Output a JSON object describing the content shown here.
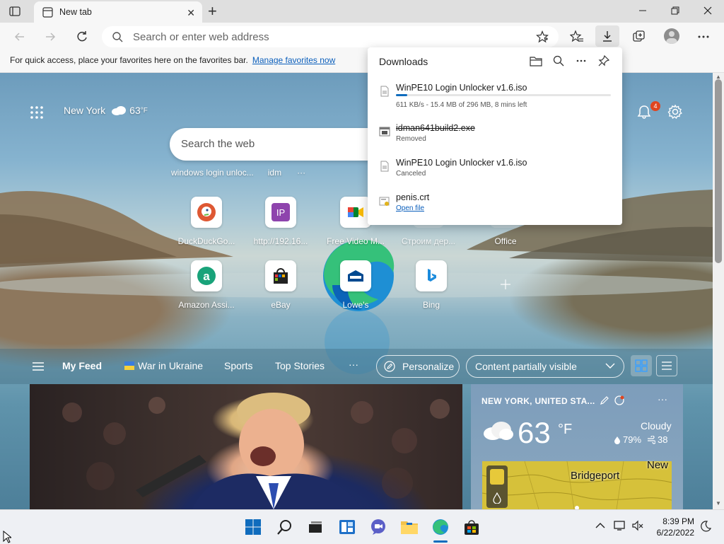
{
  "browser": {
    "tab_title": "New tab",
    "tab_close": "✕",
    "new_tab": "+",
    "omnibox_placeholder": "Search or enter web address",
    "favbar_message": "For quick access, place your favorites here on the favorites bar.",
    "favbar_link": "Manage favorites now"
  },
  "newtab": {
    "location": "New York",
    "temp": "63",
    "temp_unit": "°F",
    "search_placeholder": "Search the web",
    "recent_searches": [
      "windows login unloc...",
      "idm"
    ],
    "notifications_count": "4",
    "quick_links_row1": [
      {
        "label": "DuckDuckGo...",
        "icon": "duckduckgo-icon"
      },
      {
        "label": "http://192.16...",
        "icon": "ip-icon"
      },
      {
        "label": "Free Video M...",
        "icon": "meet-icon"
      },
      {
        "label": "Строим дер...",
        "icon": "generic-icon"
      },
      {
        "label": "Office",
        "icon": "office-icon"
      }
    ],
    "quick_links_row2": [
      {
        "label": "Amazon Assi...",
        "icon": "amazon-icon"
      },
      {
        "label": "eBay",
        "icon": "ebay-icon"
      },
      {
        "label": "Lowe's",
        "icon": "lowes-icon"
      },
      {
        "label": "Bing",
        "icon": "bing-icon"
      }
    ],
    "feed": {
      "my_feed": "My Feed",
      "tabs": [
        "War in Ukraine",
        "Sports",
        "Top Stories"
      ],
      "more": "···",
      "personalize": "Personalize",
      "content_visibility": "Content partially visible"
    },
    "weather_card": {
      "location": "NEW YORK, UNITED STA...",
      "temp": "63",
      "unit": "°F",
      "condition": "Cloudy",
      "humidity": "79%",
      "aqi": "38",
      "map_city": "Bridgeport",
      "map_state": "New"
    }
  },
  "downloads": {
    "title": "Downloads",
    "items": [
      {
        "name": "WinPE10 Login Unlocker v1.6.iso",
        "status": "611 KB/s - 15.4 MB of 296 MB, 8 mins left",
        "progress": 0.052,
        "icon": "file-icon"
      },
      {
        "name": "idman641build2.exe",
        "status": "Removed",
        "icon": "exe-icon"
      },
      {
        "name": "WinPE10 Login Unlocker v1.6.iso",
        "status": "Canceled",
        "icon": "file-icon"
      },
      {
        "name": "penis.crt",
        "status": "Open file",
        "icon": "certificate-icon"
      }
    ]
  },
  "taskbar": {
    "time": "8:39 PM",
    "date": "6/22/2022"
  },
  "colors": {
    "accent": "#0a5ebb",
    "progress": "#0f6cbd",
    "badge": "#e0451f"
  }
}
